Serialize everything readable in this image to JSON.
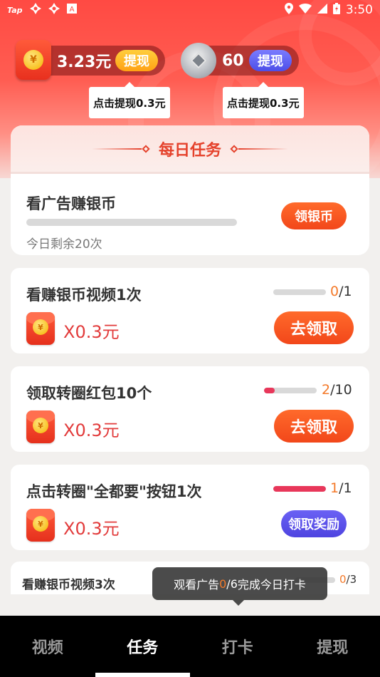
{
  "status_bar": {
    "left_icons": [
      "tap-icon",
      "pinwheel-icon",
      "pinwheel-icon",
      "a-box-icon"
    ],
    "tap_label": "Tap",
    "time": "3:50"
  },
  "wallet": {
    "cash_amount": "3.23元",
    "cash_withdraw_label": "提现",
    "cash_tip": "点击提现0.3元",
    "silver_amount": "60",
    "silver_withdraw_label": "提现",
    "silver_tip": "点击提现0.3元"
  },
  "daily": {
    "title": "每日任务",
    "ad_task": {
      "title": "看广告赚银币",
      "remaining": "今日剩余20次",
      "button_label": "领银币"
    }
  },
  "tasks": [
    {
      "title": "看赚银币视频1次",
      "reward": "X0.3元",
      "progress_current": "0",
      "progress_total": "/1",
      "progress_fraction": 0,
      "button_label": "去领取"
    },
    {
      "title": "领取转圈红包10个",
      "reward": "X0.3元",
      "progress_current": "2",
      "progress_total": "/10",
      "progress_fraction": 0.2,
      "button_label": "去领取"
    },
    {
      "title": "点击转圈\"全都要\"按钮1次",
      "reward": "X0.3元",
      "progress_current": "1",
      "progress_total": "/1",
      "progress_fraction": 1,
      "button_label": "领取奖励"
    },
    {
      "title": "看赚银币视频3次",
      "progress_current": "0",
      "progress_total": "/3",
      "progress_fraction": 0
    }
  ],
  "toast": {
    "prefix": "观看广告",
    "current": "0",
    "total": "/6",
    "suffix": "完成今日打卡"
  },
  "nav": [
    {
      "label": "视频",
      "active": false
    },
    {
      "label": "任务",
      "active": true
    },
    {
      "label": "打卡",
      "active": false
    },
    {
      "label": "提现",
      "active": false
    }
  ],
  "colors": {
    "header_red": "#ff4a43",
    "accent_orange": "#f2471a",
    "progress_red": "#e8375a",
    "purple_button": "#4e44e0"
  }
}
